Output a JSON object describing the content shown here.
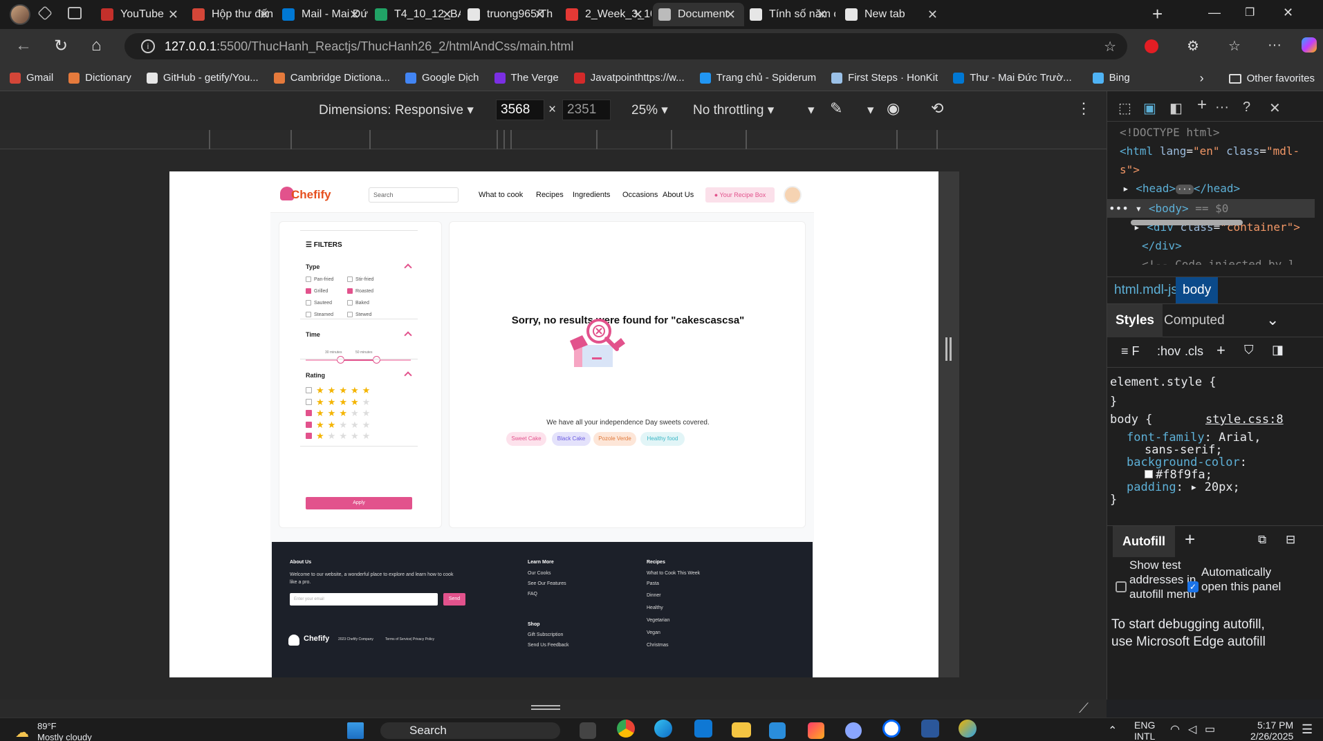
{
  "tabs": [
    {
      "title": "YouTube",
      "color": "#c4302b"
    },
    {
      "title": "Hộp thư đến",
      "color": "#d44638"
    },
    {
      "title": "Mail - Mai Đứ",
      "color": "#0078d4"
    },
    {
      "title": "T4_10_12_BÁ",
      "color": "#21a366"
    },
    {
      "title": "truong965/Th",
      "color": "#e6e6e6"
    },
    {
      "title": "2_Week_3_10",
      "color": "#e53935"
    },
    {
      "title": "Document",
      "color": "#bbbbbb"
    },
    {
      "title": "Tính số năm c",
      "color": "#e6e6e6"
    },
    {
      "title": "New tab",
      "color": "#e6e6e6"
    }
  ],
  "address": {
    "host": "127.0.0.1",
    "path": ":5500/ThucHanh_Reactjs/ThucHanh26_2/htmlAndCss/main.html"
  },
  "bookmarks": [
    {
      "label": "Gmail",
      "color": "#d44638"
    },
    {
      "label": "Dictionary",
      "color": "#e57a3c"
    },
    {
      "label": "GitHub - getify/You...",
      "color": "#e6e6e6"
    },
    {
      "label": "Cambridge Dictiona...",
      "color": "#e57a3c"
    },
    {
      "label": "Google Dịch",
      "color": "#4285f4"
    },
    {
      "label": "The Verge",
      "color": "#7b2fe3"
    },
    {
      "label": "Javatpointhttps://w...",
      "color": "#d42a2a"
    },
    {
      "label": "Trang chủ - Spiderum",
      "color": "#2196f3"
    },
    {
      "label": "First Steps · HonKit",
      "color": "#9bc1e8"
    },
    {
      "label": "Thư - Mai Đức Trườ...",
      "color": "#0078d4"
    },
    {
      "label": "Bing",
      "color": "#4fb3f5"
    }
  ],
  "bookmarks_other": "Other favorites",
  "device": {
    "dimensions": "Dimensions: Responsive",
    "width": "3568",
    "height": "2351",
    "times": "×",
    "zoom": "25%",
    "throttle": "No throttling"
  },
  "site": {
    "logo": "Chefify",
    "search_placeholder": "Search",
    "nav": [
      "What to cook",
      "Recipes",
      "Ingredients",
      "Occasions",
      "About Us"
    ],
    "recipe_box": "Your Recipe Box",
    "filters": {
      "title": "FILTERS",
      "type_label": "Type",
      "types": [
        {
          "label": "Pan-fried",
          "checked": false
        },
        {
          "label": "Stir-fried",
          "checked": false
        },
        {
          "label": "Grilled",
          "checked": true
        },
        {
          "label": "Roasted",
          "checked": true
        },
        {
          "label": "Sauteed",
          "checked": false
        },
        {
          "label": "Baked",
          "checked": false
        },
        {
          "label": "Steamed",
          "checked": false
        },
        {
          "label": "Stewed",
          "checked": false
        }
      ],
      "time_label": "Time",
      "time_min": "30 minutes",
      "time_max": "50 minutes",
      "rating_label": "Rating",
      "ratings": [
        {
          "stars": 5,
          "checked": false
        },
        {
          "stars": 4,
          "checked": false
        },
        {
          "stars": 3,
          "checked": true
        },
        {
          "stars": 2,
          "checked": true
        },
        {
          "stars": 1,
          "checked": true
        }
      ],
      "apply": "Apply"
    },
    "no_results": "Sorry, no results were found for \"cakescascsa\"",
    "subtitle": "We have all your independence Day sweets covered.",
    "tags": [
      {
        "label": "Sweet Cake",
        "bg": "#fde2ec",
        "fg": "#e2528c"
      },
      {
        "label": "Black Cake",
        "bg": "#e4e2fb",
        "fg": "#6a5be0"
      },
      {
        "label": "Pozole Verde",
        "bg": "#fde6d8",
        "fg": "#e07a3c"
      },
      {
        "label": "Healthy food",
        "bg": "#e2f5f7",
        "fg": "#3bb7c6"
      }
    ],
    "footer": {
      "about_title": "About Us",
      "about_text": "Welcome to our website, a wonderful place to explore and learn how to cook like a pro.",
      "email_placeholder": "Enter your email",
      "send": "Send",
      "learn_title": "Learn More",
      "learn_items": [
        "Our Cooks",
        "See Our Features",
        "FAQ"
      ],
      "shop_title": "Shop",
      "shop_items": [
        "Gift Subscription",
        "Send Us Feedback"
      ],
      "recipes_title": "Recipes",
      "recipes_items": [
        "What to Cook This Week",
        "Pasta",
        "Dinner",
        "Healthy",
        "Vegetarian",
        "Vegan",
        "Christmas"
      ],
      "brand": "Chefify",
      "copyright": "2023 Chefify Company",
      "terms": "Terms of Service| Privacy Policy"
    }
  },
  "devtools": {
    "code": {
      "doctype": "<!DOCTYPE html>",
      "html_tag": "<html",
      "html_attr1": "lang",
      "html_val1": "\"en\"",
      "html_attr2": "class",
      "html_val2": "\"mdl-",
      "html_cont": "s\">",
      "head": "<head>",
      "head_dots": "···",
      "head_close": "</head>",
      "body": "<body>",
      "body_eq": "== $0",
      "div_tag": "<div",
      "div_attr": "class",
      "div_val": "\"container\">",
      "div_close": "</div>",
      "comment": "<!-- Code injected by l"
    },
    "crumbs": [
      "html.mdl-js",
      "body"
    ],
    "style_tabs": [
      "Styles",
      "Computed"
    ],
    "filter_hov": ":hov",
    "filter_cls": ".cls",
    "element_style": "element.style {",
    "rule_selector": "body {",
    "rule_source": "style.css:8",
    "props": [
      {
        "name": "font-family",
        "value": "Arial,"
      },
      {
        "name": "",
        "value": "sans-serif;"
      },
      {
        "name": "background-color",
        "value": ""
      },
      {
        "name": "",
        "value": "#f8f9fa;"
      },
      {
        "name": "padding",
        "value": "▸ 20px;"
      }
    ],
    "autofill_title": "Autofill",
    "autofill_opt1": "Show test addresses in autofill menu",
    "autofill_opt2": "Automatically open this panel",
    "autofill_help": "To start debugging autofill, use Microsoft Edge autofill"
  },
  "taskbar": {
    "temp": "89°F",
    "weather": "Mostly cloudy",
    "search": "Search",
    "lang1": "ENG",
    "lang2": "INTL",
    "time": "5:17 PM",
    "date": "2/26/2025"
  }
}
